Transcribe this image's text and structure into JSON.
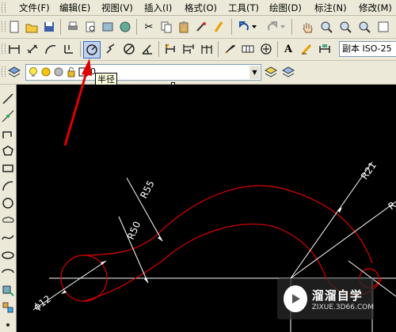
{
  "menu": {
    "items": [
      {
        "label": "文件(F)"
      },
      {
        "label": "编辑(E)"
      },
      {
        "label": "视图(V)"
      },
      {
        "label": "插入(I)"
      },
      {
        "label": "格式(O)"
      },
      {
        "label": "工具(T)"
      },
      {
        "label": "绘图(D)"
      },
      {
        "label": "标注(N)"
      },
      {
        "label": "修改(M)"
      }
    ]
  },
  "dim_toolbar": {
    "style_combo_value": "副本 ISO-25"
  },
  "tooltip": {
    "text": "半径"
  },
  "layer_toolbar": {
    "layer_combo_value": "0"
  },
  "drawing": {
    "labels": [
      "R55",
      "R50",
      "R21",
      "R",
      "ϕ12"
    ],
    "colors": {
      "curve": "#e00000",
      "dimension": "#ffffff",
      "background": "#000000"
    }
  },
  "watermark": {
    "title": "溜溜自学",
    "subtitle": "ZIXUE.3D66.COM"
  }
}
